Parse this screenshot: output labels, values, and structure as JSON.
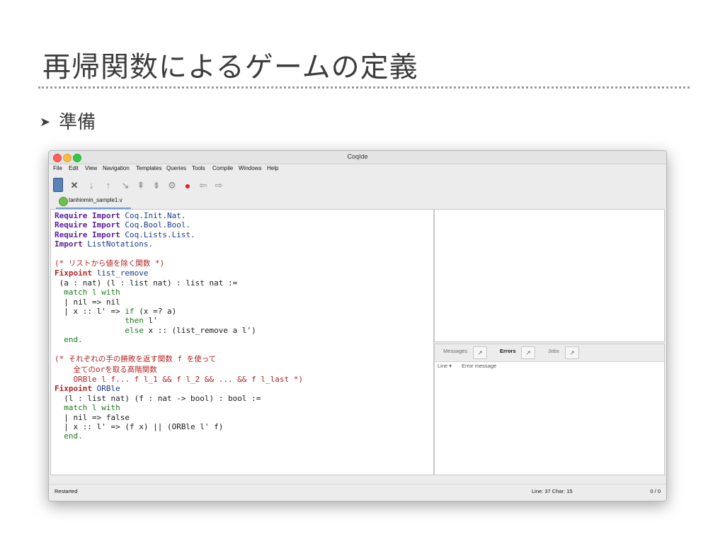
{
  "slide": {
    "title": "再帰関数によるゲームの定義",
    "bullet_arrow": "➤",
    "bullet": "準備"
  },
  "window": {
    "title": "CoqIde",
    "menu": [
      "File",
      "Edit",
      "View",
      "Navigation",
      "Templates",
      "Queries",
      "Tools",
      "Compile",
      "Windows",
      "Help"
    ],
    "toolbar_icons": [
      "save-icon",
      "close-icon",
      "step-forward-icon",
      "step-backward-icon",
      "go-to-cursor-icon",
      "go-to-start-icon",
      "go-to-end-icon",
      "fully-check-icon",
      "interrupt-icon",
      "previous-icon",
      "next-icon"
    ],
    "tab_label": "tanhinmin_sample1.v",
    "code": {
      "l1": [
        "Require",
        "Import",
        "Coq.Init.Nat."
      ],
      "l2": [
        "Require",
        "Import",
        "Coq.Bool.Bool."
      ],
      "l3": [
        "Require",
        "Import",
        "Coq.Lists.List."
      ],
      "l4": [
        "Import",
        "ListNotations."
      ],
      "c1_open": "(*",
      "c1_text": "リストから値を除く関数",
      "c1_close": "*)",
      "f1_kw": "Fixpoint",
      "f1_name": "list_remove",
      "f1_args": " (a : nat) (l : list nat) : list nat :=",
      "f1_match": "match l with",
      "f1_case1": "| nil => nil",
      "f1_case2a": "| x :: l' =>",
      "f1_if": "if",
      "f1_cond": "(x =? a)",
      "f1_then": "then",
      "f1_then_v": "l'",
      "f1_else": "else",
      "f1_else_v": "x :: (list_remove a l')",
      "f1_end": "end.",
      "c2_open": "(*",
      "c2_text1": "それぞれの手の勝敗を返す関数",
      "c2_f": "f",
      "c2_text2": "を使って",
      "c2_text3a": "全ての",
      "c2_or": "or",
      "c2_text3b": "を取る高階関数",
      "c2_code": "ORBle l f... f l_1 && f l_2 && ... && f l_last *)",
      "f2_kw": "Fixpoint",
      "f2_name": "ORBle",
      "f2_args": "(l : list nat) (f : nat -> bool) : bool :=",
      "f2_match": "match l with",
      "f2_case1": "| nil => false",
      "f2_case2": "| x :: l' => (f x) || (ORBle l' f)",
      "f2_end": "end."
    },
    "panel": {
      "tabs": [
        "Messages",
        "Errors",
        "Jobs"
      ],
      "active_tab": "Errors",
      "columns": [
        "Line",
        "Error message"
      ],
      "column_sort_arrow": "▾"
    },
    "status": {
      "left": "Restarted",
      "line_label": "Line:",
      "line_value": "37",
      "char_label": "Char:",
      "char_value": "15",
      "right": "0 / 0"
    }
  },
  "colors": {
    "keyword": "#5a1aa0",
    "fixpoint": "#b42323",
    "identifier": "#1a3c8a",
    "tactic_green": "#1d7a1d",
    "comment": "#b42323"
  }
}
